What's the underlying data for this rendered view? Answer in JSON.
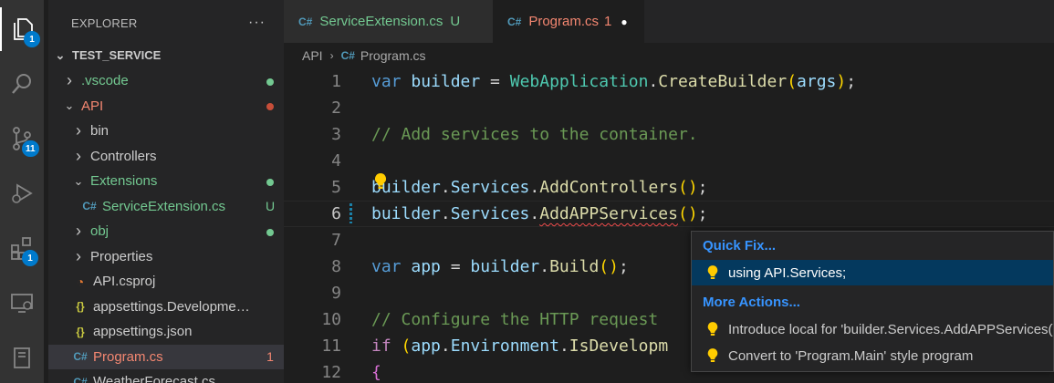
{
  "activity_bar": {
    "items": [
      {
        "icon": "explorer-icon",
        "badge": "1"
      },
      {
        "icon": "search-icon",
        "badge": ""
      },
      {
        "icon": "source-control-icon",
        "badge": "11"
      },
      {
        "icon": "run-debug-icon",
        "badge": ""
      },
      {
        "icon": "extensions-icon",
        "badge": "1"
      },
      {
        "icon": "remote-explorer-icon",
        "badge": ""
      },
      {
        "icon": "notebook-icon",
        "badge": ""
      }
    ]
  },
  "sidebar": {
    "title": "EXPLORER",
    "more": "···",
    "root": "TEST_SERVICE",
    "tree": [
      {
        "label": ".vscode",
        "type": "folder",
        "expanded": false,
        "color": "#73c991",
        "deco": "dot",
        "deco_color": "#73c991"
      },
      {
        "label": "API",
        "type": "folder",
        "expanded": true,
        "color": "#f48771",
        "deco": "dot",
        "deco_color": "#c74e39"
      },
      {
        "label": "bin",
        "type": "folder",
        "expanded": false,
        "color": "#cccccc",
        "deco": ""
      },
      {
        "label": "Controllers",
        "type": "folder",
        "expanded": false,
        "color": "#cccccc",
        "deco": ""
      },
      {
        "label": "Extensions",
        "type": "folder",
        "expanded": true,
        "color": "#73c991",
        "deco": "dot",
        "deco_color": "#73c991"
      },
      {
        "label": "ServiceExtension.cs",
        "type": "cs",
        "color": "#73c991",
        "deco": "U",
        "deco_color": "#73c991"
      },
      {
        "label": "obj",
        "type": "folder",
        "expanded": false,
        "color": "#73c991",
        "deco": "dot",
        "deco_color": "#73c991"
      },
      {
        "label": "Properties",
        "type": "folder",
        "expanded": false,
        "color": "#cccccc",
        "deco": ""
      },
      {
        "label": "API.csproj",
        "type": "rss",
        "color": "#cccccc",
        "deco": ""
      },
      {
        "label": "appsettings.Development.json",
        "type": "json",
        "color": "#cccccc",
        "deco": ""
      },
      {
        "label": "appsettings.json",
        "type": "json",
        "color": "#cccccc",
        "deco": ""
      },
      {
        "label": "Program.cs",
        "type": "cs",
        "color": "#f48771",
        "deco": "1",
        "deco_color": "#f48771",
        "selected": true
      },
      {
        "label": "WeatherForecast.cs",
        "type": "cs",
        "color": "#cccccc",
        "deco": ""
      }
    ]
  },
  "tabs": [
    {
      "label": "ServiceExtension.cs",
      "status": "U",
      "color": "#73c991",
      "active": false
    },
    {
      "label": "Program.cs",
      "status": "1",
      "color": "#f48771",
      "active": true,
      "dirty": "●"
    }
  ],
  "breadcrumb": {
    "folder": "API",
    "sep": "›",
    "file": "Program.cs"
  },
  "editor": {
    "lines": [
      {
        "n": "1"
      },
      {
        "n": "2"
      },
      {
        "n": "3"
      },
      {
        "n": "4"
      },
      {
        "n": "5"
      },
      {
        "n": "6"
      },
      {
        "n": "7"
      },
      {
        "n": "8"
      },
      {
        "n": "9"
      },
      {
        "n": "10"
      },
      {
        "n": "11"
      },
      {
        "n": "12"
      }
    ],
    "tokens": {
      "l1": {
        "var": "var",
        "builder": "builder",
        "eq": " = ",
        "cls": "WebApplication",
        "dot": ".",
        "fn": "CreateBuilder",
        "op": "(",
        "arg": "args",
        "cp": ")",
        "semi": ";"
      },
      "l3": "// Add services to the container.",
      "l5": {
        "obj": "builder",
        "dot1": ".",
        "prop": "Services",
        "dot2": ".",
        "fn": "AddControllers",
        "op": "(",
        "cp": ")",
        "semi": ";"
      },
      "l6": {
        "obj": "builder",
        "dot1": ".",
        "prop": "Services",
        "dot2": ".",
        "fn": "AddAPPServices",
        "op": "(",
        "cp": ")",
        "semi": ";"
      },
      "l8": {
        "var": "var",
        "app": "app",
        "eq": " = ",
        "obj": "builder",
        "dot": ".",
        "fn": "Build",
        "op": "(",
        "cp": ")",
        "semi": ";"
      },
      "l10": "// Configure the HTTP request",
      "l11": {
        "kw": "if",
        "sp": " ",
        "op": "(",
        "obj": "app",
        "dot1": ".",
        "prop": "Environment",
        "dot2": ".",
        "fn": "IsDevelopm"
      },
      "l12": "{"
    }
  },
  "quickfix": {
    "header": "Quick Fix...",
    "item1": "using API.Services;",
    "more_header": "More Actions...",
    "item2": "Introduce local for 'builder.Services.AddAPPServices()'",
    "item3": "Convert to 'Program.Main' style program"
  },
  "colors": {
    "accent": "#007acc",
    "lightbulb": "#ffcc00",
    "error": "#f14c4c"
  }
}
